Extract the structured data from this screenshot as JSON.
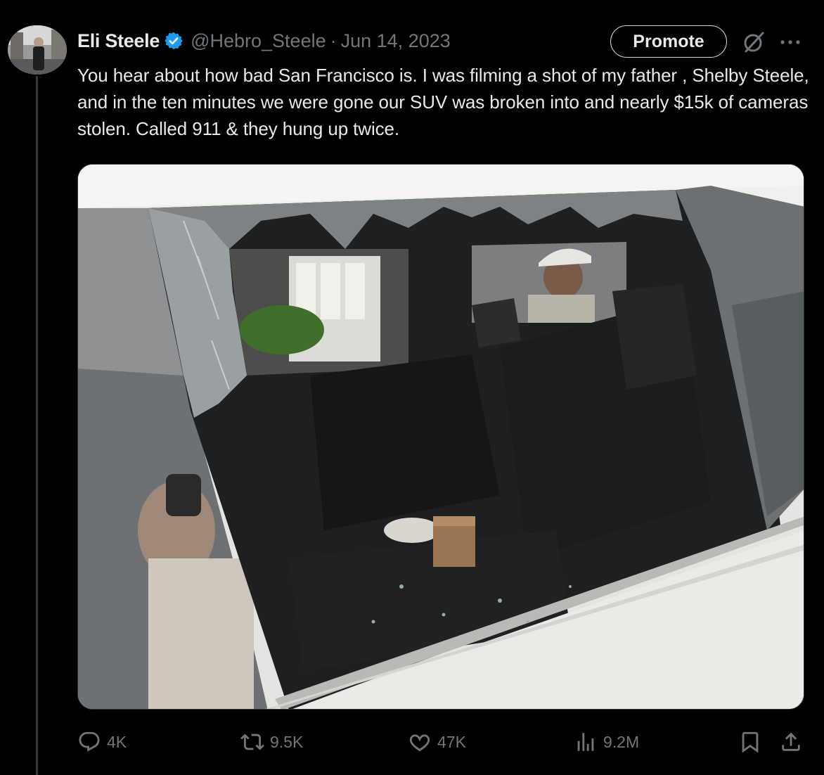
{
  "tweet": {
    "author": {
      "display_name": "Eli Steele",
      "handle": "@Hebro_Steele",
      "verified_icon": "verified-badge-icon"
    },
    "separator": "·",
    "date": "Jun 14, 2023",
    "promote_label": "Promote",
    "text": "You hear about how bad San Francisco is. I was filming a shot of my father , Shelby Steele, and in the ten minutes we were gone our SUV was broken into and nearly $15k of cameras stolen. Called 911 & they hung up twice.",
    "stats": {
      "replies": "4K",
      "reposts": "9.5K",
      "likes": "47K",
      "views": "9.2M"
    }
  },
  "colors": {
    "background": "#000000",
    "primary_text": "#e7e9ea",
    "secondary_text": "#71767b",
    "verified_blue": "#1d9bf0",
    "divider": "#333639"
  }
}
